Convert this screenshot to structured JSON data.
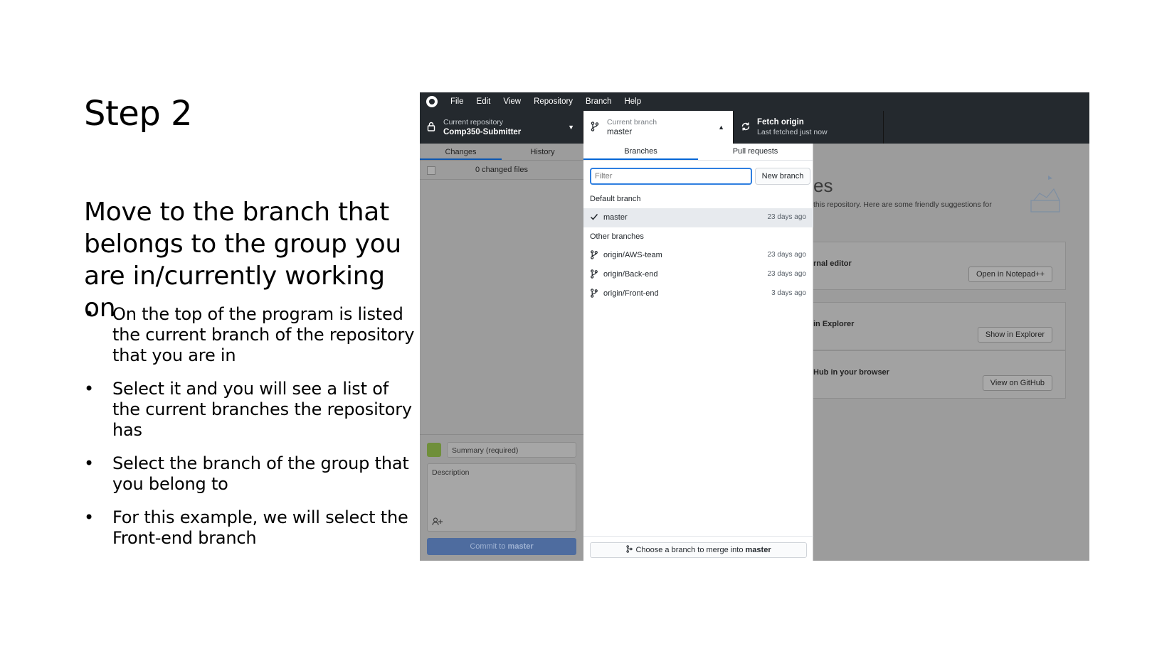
{
  "slide": {
    "title": "Step 2",
    "heading": "Move to the branch that belongs to the group you are in/currently working on",
    "bullets": [
      "On the top of the program is listed the current branch of the repository that you are in",
      "Select it and you will see a list of the current branches the repository has",
      "Select the branch of the group that you belong to",
      "For this example, we will select the Front-end branch"
    ]
  },
  "app": {
    "menu": [
      "File",
      "Edit",
      "View",
      "Repository",
      "Branch",
      "Help"
    ],
    "toolbar": {
      "repo_label": "Current repository",
      "repo_name": "Comp350-Submitter",
      "branch_label": "Current branch",
      "branch_name": "master",
      "fetch_title": "Fetch origin",
      "fetch_sub": "Last fetched just now"
    },
    "left_panel": {
      "tabs": [
        "Changes",
        "History"
      ],
      "changed_files": "0 changed files",
      "summary_placeholder": "Summary (required)",
      "description_placeholder": "Description",
      "commit_button_prefix": "Commit to ",
      "commit_button_branch": "master"
    },
    "branch_dropdown": {
      "tabs": [
        "Branches",
        "Pull requests"
      ],
      "filter_placeholder": "Filter",
      "new_branch": "New branch",
      "default_group": "Default branch",
      "default_branches": [
        {
          "name": "master",
          "ago": "23 days ago"
        }
      ],
      "other_group": "Other branches",
      "other_branches": [
        {
          "name": "origin/AWS-team",
          "ago": "23 days ago"
        },
        {
          "name": "origin/Back-end",
          "ago": "23 days ago"
        },
        {
          "name": "origin/Front-end",
          "ago": "3 days ago"
        }
      ],
      "merge_prefix": "Choose a branch to merge into ",
      "merge_branch": "master"
    },
    "right_area": {
      "title_fragment": "es",
      "subtitle_fragment": "this repository. Here are some friendly suggestions for",
      "cards": [
        {
          "label": "rnal editor",
          "button": "Open in Notepad++"
        },
        {
          "label": "in Explorer",
          "button": "Show in Explorer"
        },
        {
          "label": "Hub in your browser",
          "button": "View on GitHub"
        }
      ]
    }
  }
}
